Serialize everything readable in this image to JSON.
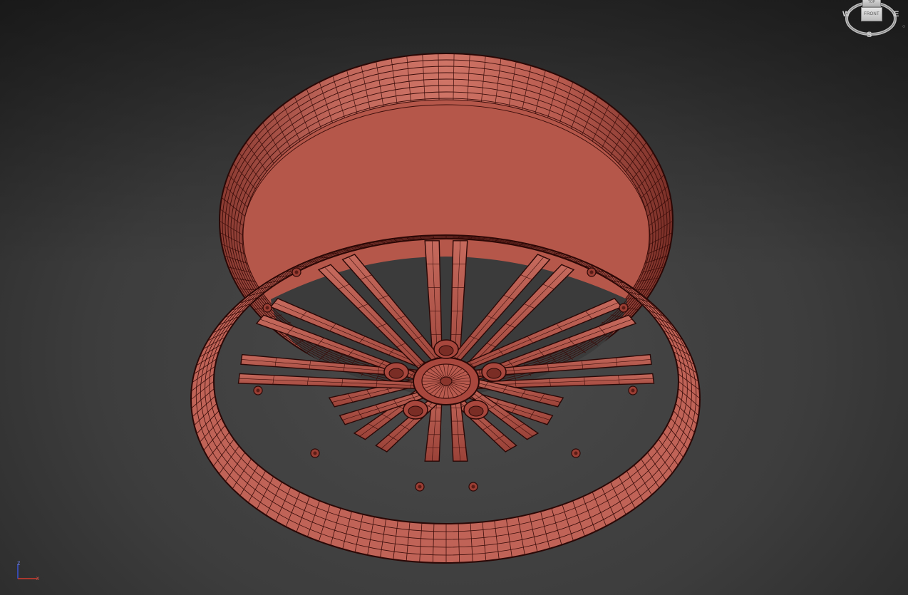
{
  "viewcube": {
    "face_label": "FRONT",
    "top_label": "TOP",
    "compass_west": "W",
    "compass_east": "E",
    "compass_south": "S"
  },
  "axis_gizmo": {
    "z_label": "z",
    "x_label": "x"
  },
  "colors": {
    "viewport_background": "#3d3d3d",
    "mesh_fill": "#b8584b",
    "mesh_wire": "#3a0d0a",
    "axis_x": "#d23a2e",
    "axis_z": "#3a52d6"
  },
  "object": {
    "icon": "wheel-rim-mesh"
  }
}
